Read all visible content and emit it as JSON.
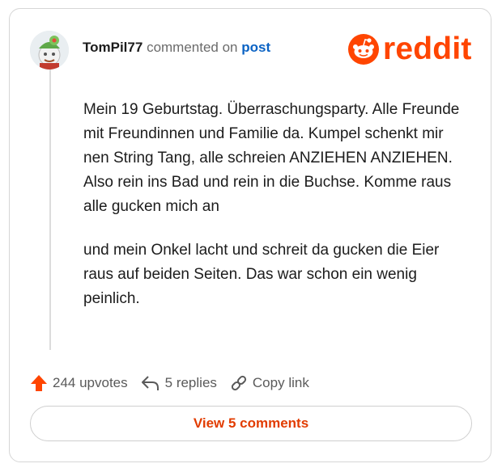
{
  "comment": {
    "username": "TomPil77",
    "action_text": "commented on",
    "post_link": "post",
    "paragraphs": [
      "Mein 19 Geburtstag. Überraschungsparty. Alle Freunde mit Freundinnen und Familie da. Kumpel schenkt mir nen String Tang, alle schreien ANZIEHEN ANZIEHEN. Also rein ins Bad und rein in die Buchse. Komme raus alle gucken mich an",
      "und mein Onkel lacht und schreit da gucken die Eier raus auf beiden Seiten. Das war schon ein wenig peinlich."
    ]
  },
  "brand": {
    "logo_text": "reddit",
    "color": "#ff4500"
  },
  "actions": {
    "upvotes": "244 upvotes",
    "replies": "5 replies",
    "copy_link": "Copy link"
  },
  "footer": {
    "view_comments_label": "View 5 comments"
  },
  "icons": {
    "avatar": "user-avatar",
    "upvote": "upvote-arrow-icon",
    "reply": "reply-arrow-icon",
    "link": "link-icon",
    "logo": "reddit-snoo-icon"
  }
}
